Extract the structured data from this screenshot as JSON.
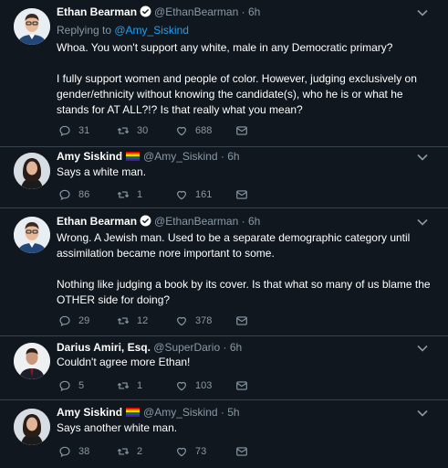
{
  "tweets": [
    {
      "name": "Ethan Bearman",
      "handle": "@EthanBearman",
      "time": "· 6h",
      "replying_prefix": "Replying to ",
      "replying_to": "@Amy_Siskind",
      "text1": "Whoa. You won't support any white, male in any Democratic primary?",
      "text2": "I fully support women and people of color. However, judging exclusively on gender/ethnicity without knowing the candidate(s), who he is or what he stands for AT ALL?!? Is that really what you mean?",
      "replies": "31",
      "retweets": "30",
      "likes": "688"
    },
    {
      "name": "Amy Siskind",
      "handle": "@Amy_Siskind",
      "time": "· 6h",
      "text1": "Says a white man.",
      "replies": "86",
      "retweets": "1",
      "likes": "161"
    },
    {
      "name": "Ethan Bearman",
      "handle": "@EthanBearman",
      "time": "· 6h",
      "text1": "Wrong. A Jewish man. Used to be a separate demographic category until assimilation became nore important  to some.",
      "text2": "Nothing like judging a book by its cover. Is that what so many of us blame the OTHER side for doing?",
      "replies": "29",
      "retweets": "12",
      "likes": "378"
    },
    {
      "name": "Darius Amiri, Esq.",
      "handle": "@SuperDario",
      "time": "· 6h",
      "text1": "Couldn't agree more Ethan!",
      "replies": "5",
      "retweets": "1",
      "likes": "103"
    },
    {
      "name": "Amy Siskind",
      "handle": "@Amy_Siskind",
      "time": "· 5h",
      "text1": "Says another white man.",
      "replies": "38",
      "retweets": "2",
      "likes": "73"
    }
  ],
  "colors": {
    "background": "#10171e",
    "secondary_text": "#8899a6",
    "link": "#1da1f2",
    "divider": "#38444d"
  },
  "icons": [
    "verified-icon",
    "pride-flag-icon",
    "chevron-down-icon",
    "reply-icon",
    "retweet-icon",
    "like-icon",
    "dm-icon"
  ]
}
